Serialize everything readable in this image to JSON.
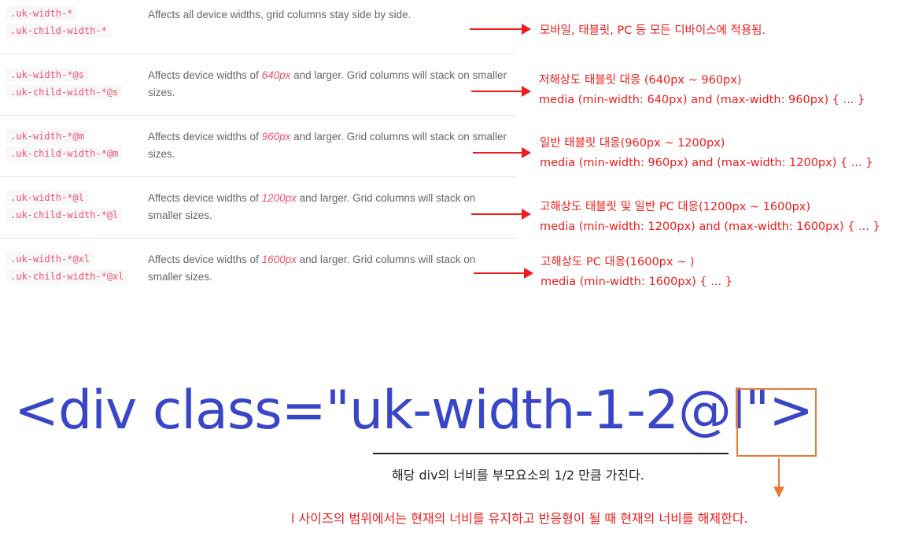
{
  "table": {
    "rows": [
      {
        "codes": [
          ".uk-width-*",
          ".uk-child-width-*"
        ],
        "desc_prefix": "Affects all device widths, grid columns stay side by side.",
        "desc_size": "",
        "desc_suffix": ""
      },
      {
        "codes": [
          ".uk-width-*@s",
          ".uk-child-width-*@s"
        ],
        "desc_prefix": "Affects device widths of ",
        "desc_size": "640px",
        "desc_suffix": " and larger. Grid columns will stack on smaller sizes."
      },
      {
        "codes": [
          ".uk-width-*@m",
          ".uk-child-width-*@m"
        ],
        "desc_prefix": "Affects device widths of ",
        "desc_size": "960px",
        "desc_suffix": " and larger. Grid columns will stack on smaller sizes."
      },
      {
        "codes": [
          ".uk-width-*@l",
          ".uk-child-width-*@l"
        ],
        "desc_prefix": "Affects device widths of ",
        "desc_size": "1200px",
        "desc_suffix": " and larger. Grid columns will stack on smaller sizes."
      },
      {
        "codes": [
          ".uk-width-*@xl",
          ".uk-child-width-*@xl"
        ],
        "desc_prefix": "Affects device widths of ",
        "desc_size": "1600px",
        "desc_suffix": " and larger. Grid columns will stack on smaller sizes."
      }
    ]
  },
  "annotations": [
    {
      "line1": "모바일, 태블릿, PC 등 모든 디바이스에 적용됨.",
      "line2": ""
    },
    {
      "line1": "저해상도 태블릿 대응 (640px ~ 960px)",
      "line2": "media (min-width: 640px) and (max-width: 960px) { ... }"
    },
    {
      "line1": "일반 태블릿 대응(960px ~ 1200px)",
      "line2": "media (min-width: 960px) and (max-width: 1200px) { ... }"
    },
    {
      "line1": "고해상도 태블릿 및 일반 PC 대응(1200px ~ 1600px)",
      "line2": "media (min-width: 1200px) and (max-width: 1600px) { ... }"
    },
    {
      "line1": "고해상도 PC 대응(1600px ~  )",
      "line2": "media (min-width: 1600px) { ... }"
    }
  ],
  "example": {
    "code": "<div class=\"uk-width-1-2@l\">",
    "caption": "해당 div의 너비를 부모요소의 1/2 만큼 가진다.",
    "note": "l 사이즈의 범위에서는 현재의 너비를 유지하고 반응형이 될 때 현재의 너비를 해제한다."
  },
  "colors": {
    "code_text": "#f0506e",
    "annotation": "#ee1c1c",
    "example_code": "#3a46c8",
    "highlight_box": "#e87a3a"
  }
}
